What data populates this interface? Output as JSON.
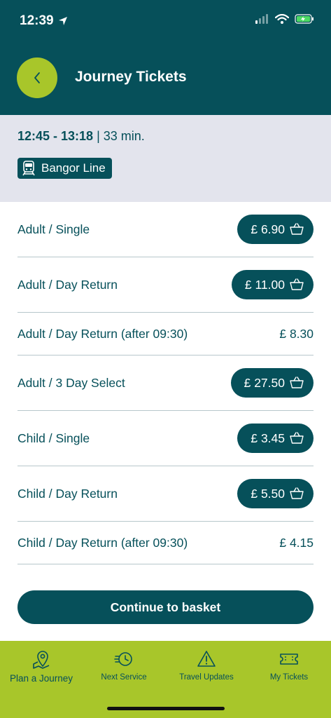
{
  "status_bar": {
    "time": "12:39"
  },
  "header": {
    "title": "Journey Tickets"
  },
  "journey": {
    "time_range": "12:45 - 13:18",
    "separator": " | ",
    "duration": "33 min.",
    "line_name": "Bangor Line"
  },
  "tickets": [
    {
      "name": "Adult / Single",
      "price": "£ 6.90"
    },
    {
      "name": "Adult / Day Return",
      "price": "£ 11.00"
    },
    {
      "name": "Adult / Day Return (after 09:30)",
      "price": "£ 8.30"
    },
    {
      "name": "Adult / 3 Day Select",
      "price": "£ 27.50"
    },
    {
      "name": "Child / Single",
      "price": "£ 3.45"
    },
    {
      "name": "Child / Day Return",
      "price": "£ 5.50"
    },
    {
      "name": "Child / Day Return (after 09:30)",
      "price": "£ 4.15"
    }
  ],
  "continue_label": "Continue to basket",
  "tabs": [
    {
      "label": "Plan a Journey",
      "icon": "map-pin-icon"
    },
    {
      "label": "Next Service",
      "icon": "fast-clock-icon"
    },
    {
      "label": "Travel Updates",
      "icon": "warning-icon"
    },
    {
      "label": "My Tickets",
      "icon": "ticket-icon"
    }
  ],
  "colors": {
    "primary": "#06505a",
    "accent": "#a8c62a",
    "journey_bg": "#e3e4ed"
  }
}
